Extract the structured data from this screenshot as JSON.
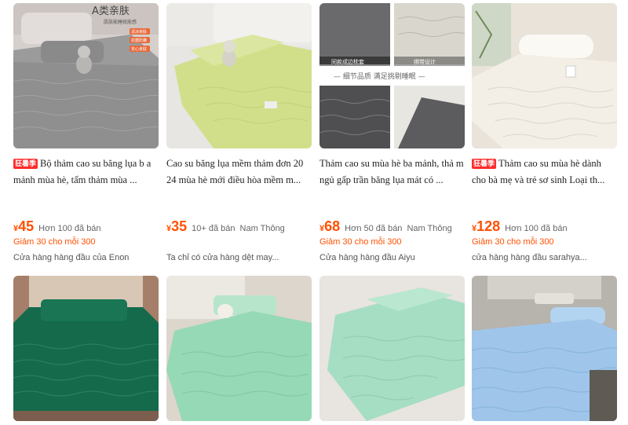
{
  "products": [
    {
      "badge": "狂暑季",
      "title": "Bộ thảm cao su băng lụa b a mảnh mùa hè, tấm thảm mùa ...",
      "currency": "¥",
      "price": "45",
      "sold": "Hơn 100 đã bán",
      "location": "",
      "promo": "Giảm 30 cho mỗi 300",
      "shop": "Cửa hàng hàng đầu của Enon",
      "image_text_1": "A类亲肤",
      "image_text_2": "肌肤能睡就能感",
      "image_text_3": "清凉亲肤",
      "image_text_4": "抗菌防螨",
      "image_text_5": "安心亲肤",
      "colors": {
        "bg": "#cfc9c6",
        "mat": "#8f8f90"
      }
    },
    {
      "badge": "",
      "title": "Cao su băng lụa mềm thảm đơn 20 24 mùa hè mới điều hòa mềm m...",
      "currency": "¥",
      "price": "35",
      "sold": "10+ đã bán",
      "location": "Nam Thông",
      "promo": "",
      "shop": "Ta chỉ có cửa hàng dệt may...",
      "colors": {
        "bg": "#e7e6e3",
        "mat": "#d1df8a"
      }
    },
    {
      "badge": "",
      "title": "Thảm cao su mùa hè ba mảnh, thả m ngủ gấp trần băng lụa mát có ...",
      "currency": "¥",
      "price": "68",
      "sold": "Hơn 50 đã bán",
      "location": "Nam Thông",
      "promo": "Giảm 30 cho mỗi 300",
      "shop": "Cửa hàng hàng đầu Aiyu",
      "image_text_1": "同款成边枕套",
      "image_text_2": "绑带设计",
      "image_text_3": "— 细节品质 满足挑剔睡眠 —",
      "colors": {
        "bg": "#ffffff",
        "mat": "#5c5c5e"
      }
    },
    {
      "badge": "狂暑季",
      "title": "Thảm cao su mùa hè dành cho bà mẹ và trẻ sơ sinh Loại th...",
      "currency": "¥",
      "price": "128",
      "sold": "Hơn 100 đã bán",
      "location": "",
      "promo": "Giảm 30 cho mỗi 300",
      "shop": "cửa hàng hàng đầu sarahya...",
      "colors": {
        "bg": "#e9e3da",
        "mat": "#f3efe6"
      }
    },
    {
      "colors": {
        "bg": "#a57f6a",
        "mat": "#156a4c"
      }
    },
    {
      "colors": {
        "bg": "#dcd6cd",
        "mat": "#96d9b6"
      }
    },
    {
      "colors": {
        "bg": "#e8e4df",
        "mat": "#a6dec3"
      }
    },
    {
      "colors": {
        "bg": "#b7b3ad",
        "mat": "#9fc6ea"
      }
    }
  ]
}
